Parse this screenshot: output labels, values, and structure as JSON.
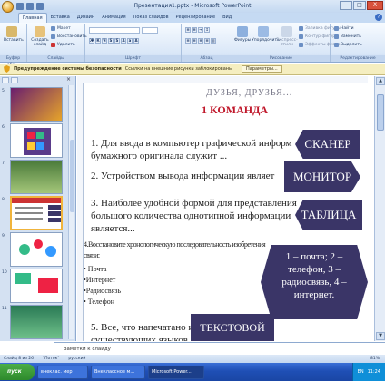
{
  "window": {
    "title": "Презентация1.pptx - Microsoft PowerPoint",
    "buttons": [
      "–",
      "□",
      "X"
    ]
  },
  "tabs": [
    "Главная",
    "Вставка",
    "Дизайн",
    "Анимация",
    "Показ слайдов",
    "Рецензирование",
    "Вид"
  ],
  "ribbon": {
    "clipboard": {
      "label": "Буфер обм...",
      "paste": "Вставить",
      "cut": "Вырезать",
      "copy": "Копировать",
      "format": "Формат"
    },
    "slides": {
      "label": "Слайды",
      "new": "Создать слайд",
      "layout": "Макет",
      "reset": "Восстановить",
      "delete": "Удалить"
    },
    "font": {
      "label": "Шрифт"
    },
    "paragraph": {
      "label": "Абзац"
    },
    "drawing": {
      "label": "Рисование",
      "shapes": "Фигуры",
      "arrange": "Упорядочить",
      "styles": "Экспресс-стили",
      "fill": "Заливка фигуры",
      "outline": "Контур фигуры",
      "effects": "Эффекты фигур"
    },
    "editing": {
      "label": "Редактирование",
      "find": "Найти",
      "replace": "Заменить",
      "select": "Выделить"
    }
  },
  "security": {
    "label": "Предупреждение системы безопасности",
    "message": "Ссылки на внешние рисунки заблокированы",
    "options": "Параметры..."
  },
  "slide": {
    "header": "ДУЗЬЯ, ДРУЗЬЯ...",
    "command": "1 КОМАНДА",
    "q1": [
      "1. Для ввода в компьютер графической информ",
      "бумажного оригинала служит ..."
    ],
    "q2": "2. Устройством вывода информации являет",
    "q3": [
      "3. Наиболее удобной формой для представления",
      "большого количества однотипной информации",
      "является..."
    ],
    "q4": [
      "4.Восстановите хронологическую последовательность изобретения",
      "связи:"
    ],
    "list": [
      "• Почта",
      "•Интернет",
      "•Радиосвязь",
      "• Телефон"
    ],
    "q5": [
      "5. Все, что напечатано и",
      "существующих языков"
    ],
    "answers": {
      "a1": "СКАНЕР",
      "a2": "МОНИТОР",
      "a3": "ТАБЛИЦА",
      "a4": [
        "1 – почта; 2 –",
        "телефон, 3 –",
        "радиосвязь, 4 –",
        "интернет."
      ],
      "a5": "ТЕКСТОВОЙ"
    }
  },
  "thumbnails": [
    5,
    6,
    7,
    8,
    9,
    10,
    11
  ],
  "notes": "Заметки к слайду",
  "status": {
    "slide": "Слайд 8 из 26",
    "theme": "\"Поток\"",
    "lang": "русский",
    "zoom": "81%"
  },
  "taskbar": {
    "start": "пуск",
    "items": [
      "внеклас. мер",
      "Внеклассное м...",
      "Microsoft Power..."
    ],
    "lang": "EN",
    "time": "11:24"
  }
}
